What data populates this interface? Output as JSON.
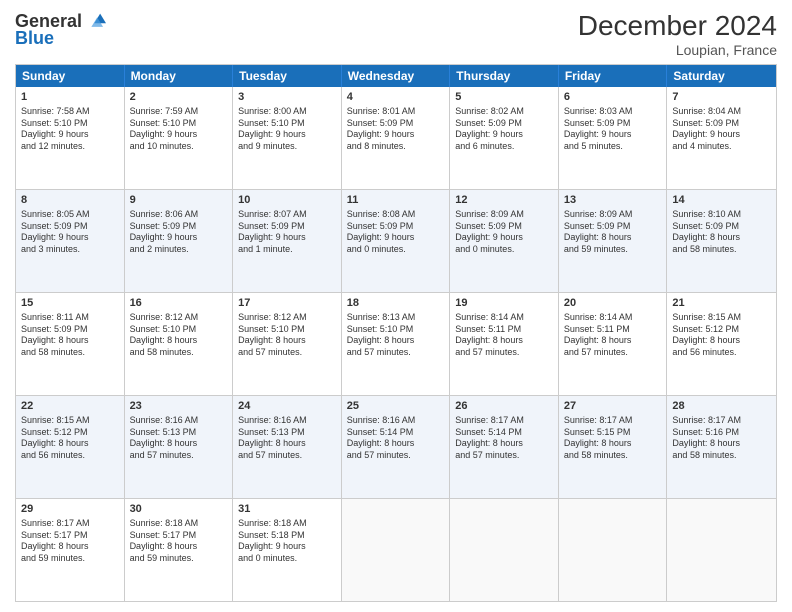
{
  "logo": {
    "general": "General",
    "blue": "Blue"
  },
  "title": "December 2024",
  "location": "Loupian, France",
  "days_of_week": [
    "Sunday",
    "Monday",
    "Tuesday",
    "Wednesday",
    "Thursday",
    "Friday",
    "Saturday"
  ],
  "rows": [
    [
      {
        "day": "1",
        "info": "Sunrise: 7:58 AM\nSunset: 5:10 PM\nDaylight: 9 hours\nand 12 minutes."
      },
      {
        "day": "2",
        "info": "Sunrise: 7:59 AM\nSunset: 5:10 PM\nDaylight: 9 hours\nand 10 minutes."
      },
      {
        "day": "3",
        "info": "Sunrise: 8:00 AM\nSunset: 5:10 PM\nDaylight: 9 hours\nand 9 minutes."
      },
      {
        "day": "4",
        "info": "Sunrise: 8:01 AM\nSunset: 5:09 PM\nDaylight: 9 hours\nand 8 minutes."
      },
      {
        "day": "5",
        "info": "Sunrise: 8:02 AM\nSunset: 5:09 PM\nDaylight: 9 hours\nand 6 minutes."
      },
      {
        "day": "6",
        "info": "Sunrise: 8:03 AM\nSunset: 5:09 PM\nDaylight: 9 hours\nand 5 minutes."
      },
      {
        "day": "7",
        "info": "Sunrise: 8:04 AM\nSunset: 5:09 PM\nDaylight: 9 hours\nand 4 minutes."
      }
    ],
    [
      {
        "day": "8",
        "info": "Sunrise: 8:05 AM\nSunset: 5:09 PM\nDaylight: 9 hours\nand 3 minutes."
      },
      {
        "day": "9",
        "info": "Sunrise: 8:06 AM\nSunset: 5:09 PM\nDaylight: 9 hours\nand 2 minutes."
      },
      {
        "day": "10",
        "info": "Sunrise: 8:07 AM\nSunset: 5:09 PM\nDaylight: 9 hours\nand 1 minute."
      },
      {
        "day": "11",
        "info": "Sunrise: 8:08 AM\nSunset: 5:09 PM\nDaylight: 9 hours\nand 0 minutes."
      },
      {
        "day": "12",
        "info": "Sunrise: 8:09 AM\nSunset: 5:09 PM\nDaylight: 9 hours\nand 0 minutes."
      },
      {
        "day": "13",
        "info": "Sunrise: 8:09 AM\nSunset: 5:09 PM\nDaylight: 8 hours\nand 59 minutes."
      },
      {
        "day": "14",
        "info": "Sunrise: 8:10 AM\nSunset: 5:09 PM\nDaylight: 8 hours\nand 58 minutes."
      }
    ],
    [
      {
        "day": "15",
        "info": "Sunrise: 8:11 AM\nSunset: 5:09 PM\nDaylight: 8 hours\nand 58 minutes."
      },
      {
        "day": "16",
        "info": "Sunrise: 8:12 AM\nSunset: 5:10 PM\nDaylight: 8 hours\nand 58 minutes."
      },
      {
        "day": "17",
        "info": "Sunrise: 8:12 AM\nSunset: 5:10 PM\nDaylight: 8 hours\nand 57 minutes."
      },
      {
        "day": "18",
        "info": "Sunrise: 8:13 AM\nSunset: 5:10 PM\nDaylight: 8 hours\nand 57 minutes."
      },
      {
        "day": "19",
        "info": "Sunrise: 8:14 AM\nSunset: 5:11 PM\nDaylight: 8 hours\nand 57 minutes."
      },
      {
        "day": "20",
        "info": "Sunrise: 8:14 AM\nSunset: 5:11 PM\nDaylight: 8 hours\nand 57 minutes."
      },
      {
        "day": "21",
        "info": "Sunrise: 8:15 AM\nSunset: 5:12 PM\nDaylight: 8 hours\nand 56 minutes."
      }
    ],
    [
      {
        "day": "22",
        "info": "Sunrise: 8:15 AM\nSunset: 5:12 PM\nDaylight: 8 hours\nand 56 minutes."
      },
      {
        "day": "23",
        "info": "Sunrise: 8:16 AM\nSunset: 5:13 PM\nDaylight: 8 hours\nand 57 minutes."
      },
      {
        "day": "24",
        "info": "Sunrise: 8:16 AM\nSunset: 5:13 PM\nDaylight: 8 hours\nand 57 minutes."
      },
      {
        "day": "25",
        "info": "Sunrise: 8:16 AM\nSunset: 5:14 PM\nDaylight: 8 hours\nand 57 minutes."
      },
      {
        "day": "26",
        "info": "Sunrise: 8:17 AM\nSunset: 5:14 PM\nDaylight: 8 hours\nand 57 minutes."
      },
      {
        "day": "27",
        "info": "Sunrise: 8:17 AM\nSunset: 5:15 PM\nDaylight: 8 hours\nand 58 minutes."
      },
      {
        "day": "28",
        "info": "Sunrise: 8:17 AM\nSunset: 5:16 PM\nDaylight: 8 hours\nand 58 minutes."
      }
    ],
    [
      {
        "day": "29",
        "info": "Sunrise: 8:17 AM\nSunset: 5:17 PM\nDaylight: 8 hours\nand 59 minutes."
      },
      {
        "day": "30",
        "info": "Sunrise: 8:18 AM\nSunset: 5:17 PM\nDaylight: 8 hours\nand 59 minutes."
      },
      {
        "day": "31",
        "info": "Sunrise: 8:18 AM\nSunset: 5:18 PM\nDaylight: 9 hours\nand 0 minutes."
      },
      {
        "day": "",
        "info": ""
      },
      {
        "day": "",
        "info": ""
      },
      {
        "day": "",
        "info": ""
      },
      {
        "day": "",
        "info": ""
      }
    ]
  ]
}
